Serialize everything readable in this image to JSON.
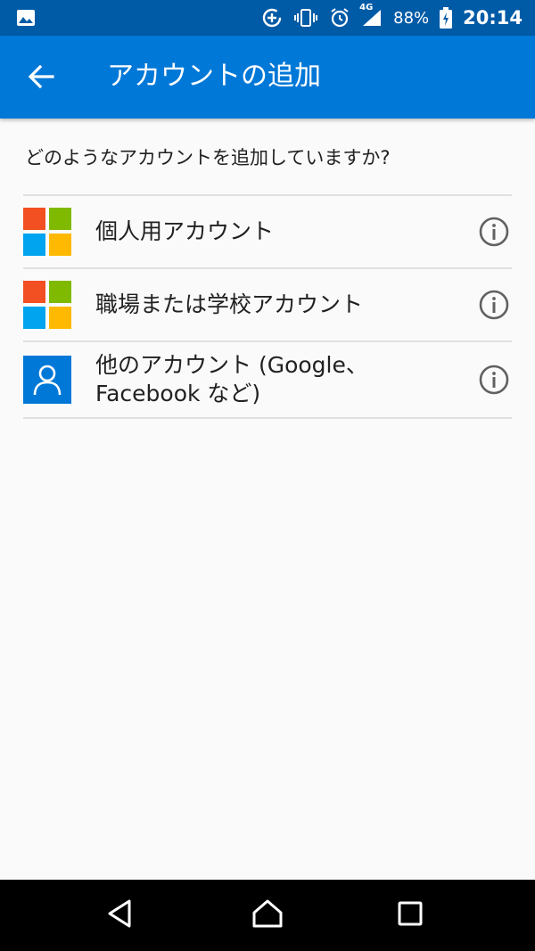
{
  "status_bar": {
    "battery": "88%",
    "time": "20:14",
    "network": "4G",
    "icons": [
      "image-icon",
      "data-saver-icon",
      "vibrate-icon",
      "alarm-icon",
      "signal-icon",
      "battery-charging-icon"
    ]
  },
  "app_bar": {
    "title": "アカウントの追加",
    "back_icon": "arrow-left-icon"
  },
  "prompt": "どのようなアカウントを追加していますか?",
  "accounts": [
    {
      "label": "個人用アカウント",
      "icon": "microsoft-logo-icon",
      "info_icon": "info-icon"
    },
    {
      "label": "職場または学校アカウント",
      "icon": "microsoft-logo-icon",
      "info_icon": "info-icon"
    },
    {
      "label_line1": "他のアカウント (Google、",
      "label_line2": "Facebook など)",
      "icon": "person-icon",
      "info_icon": "info-icon"
    }
  ],
  "colors": {
    "status_bar": "#005ba6",
    "app_bar": "#0078d7",
    "ms_red": "#f25022",
    "ms_green": "#7fba00",
    "ms_blue": "#00a4ef",
    "ms_yellow": "#ffb900",
    "person_tile": "#0078d7"
  },
  "nav_bar": {
    "icons": [
      "back-triangle-icon",
      "home-icon",
      "recents-icon"
    ]
  }
}
